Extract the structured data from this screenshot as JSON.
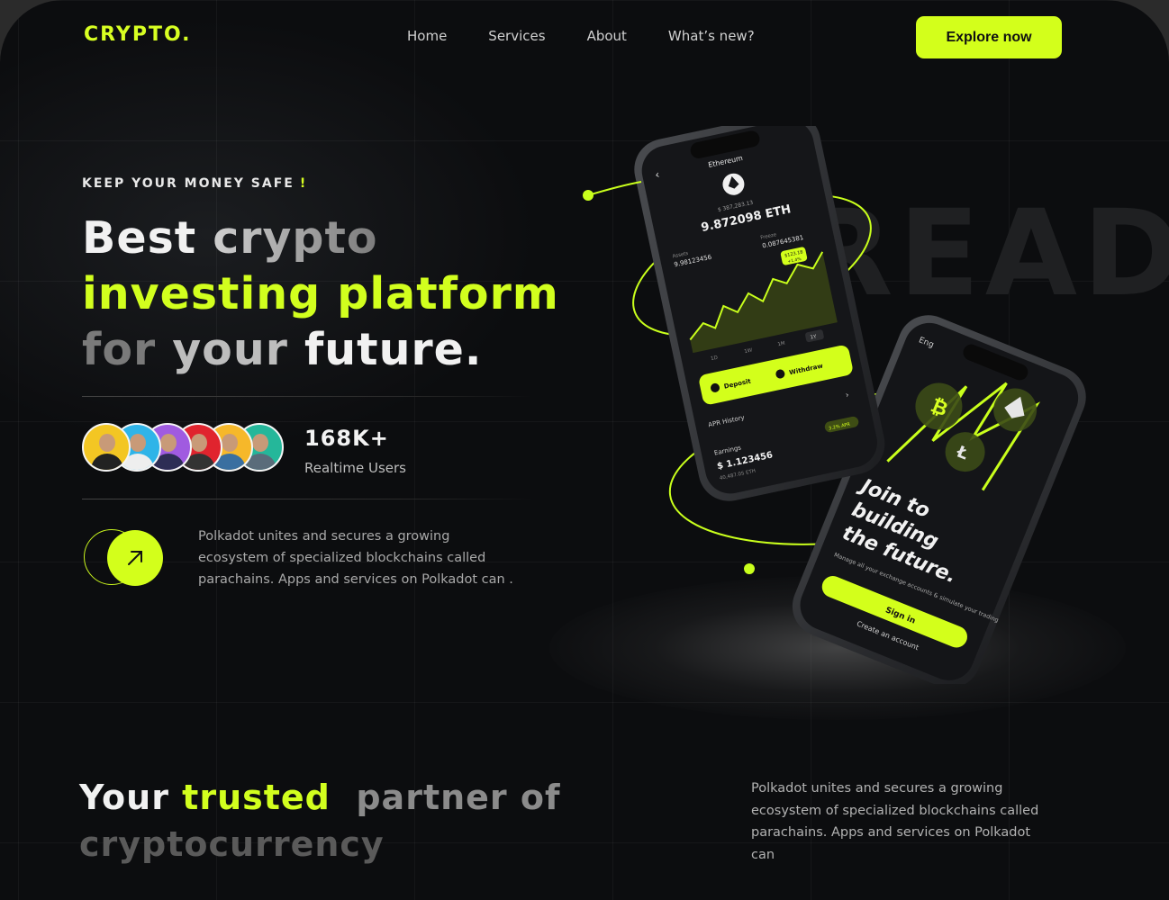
{
  "brand": {
    "logo": "CRYPTO.",
    "accent": "#d3ff1b"
  },
  "nav": {
    "items": [
      "Home",
      "Services",
      "About",
      "What’s new?"
    ]
  },
  "header": {
    "cta_label": "Explore now"
  },
  "hero": {
    "eyebrow": "KEEP YOUR MONEY SAFE",
    "eyebrow_mark": "!",
    "line1": {
      "a": "Best",
      "b": "crypto"
    },
    "line2": "investing platform",
    "line3": {
      "a": "for",
      "b": "your",
      "c": "future."
    },
    "background_word": "READ"
  },
  "stats": {
    "users_count": "168K+",
    "users_label": "Realtime Users"
  },
  "avatars": [
    {
      "color": "#f3c623",
      "shirt": "#222"
    },
    {
      "color": "#2fb4e8",
      "shirt": "#eee"
    },
    {
      "color": "#a05be0",
      "shirt": "#2d2d55"
    },
    {
      "color": "#e0242e",
      "shirt": "#333"
    },
    {
      "color": "#f6b82a",
      "shirt": "#3a6fa0"
    },
    {
      "color": "#25b79a",
      "shirt": "#5a6c7a"
    }
  ],
  "arrow_icon": "arrow-up-right-icon",
  "description": "Polkadot unites and secures a growing ecosystem of specialized blockchains called parachains. Apps and services on Polkadot can .",
  "phone1": {
    "title": "Ethereum",
    "balance_small": "$ 387,283.13",
    "balance": "9.872098 ETH",
    "stat_a_label": "Assets",
    "stat_a_value": "9.98123456",
    "stat_b_label": "Freeze",
    "stat_b_value": "0.087645381",
    "tooltip_a": "$123.18",
    "tooltip_b": "+1.4%",
    "chart_ticks": [
      "1D",
      "1W",
      "1M",
      "1Y"
    ],
    "deposit_label": "Deposit",
    "withdraw_label": "Withdraw",
    "history_label": "APR History",
    "earnings_label": "Earnings",
    "earnings_value": "$ 1.123456",
    "earnings_sub": "40,487.05 ETH",
    "apr_badge": "3.2% APR"
  },
  "phone2": {
    "lang": "Eng",
    "headline": [
      "Join to",
      "building",
      "the future."
    ],
    "sub": "Manage all your exchange accounts & simulate your trading",
    "signin_label": "Sign in",
    "create_label": "Create an account"
  },
  "section2": {
    "title_a": "Your",
    "title_b": "trusted",
    "title_c": "partner of",
    "title_line2": "cryptocurrency",
    "description": "Polkadot unites and secures a growing ecosystem of specialized blockchains called parachains. Apps and services on Polkadot can"
  }
}
